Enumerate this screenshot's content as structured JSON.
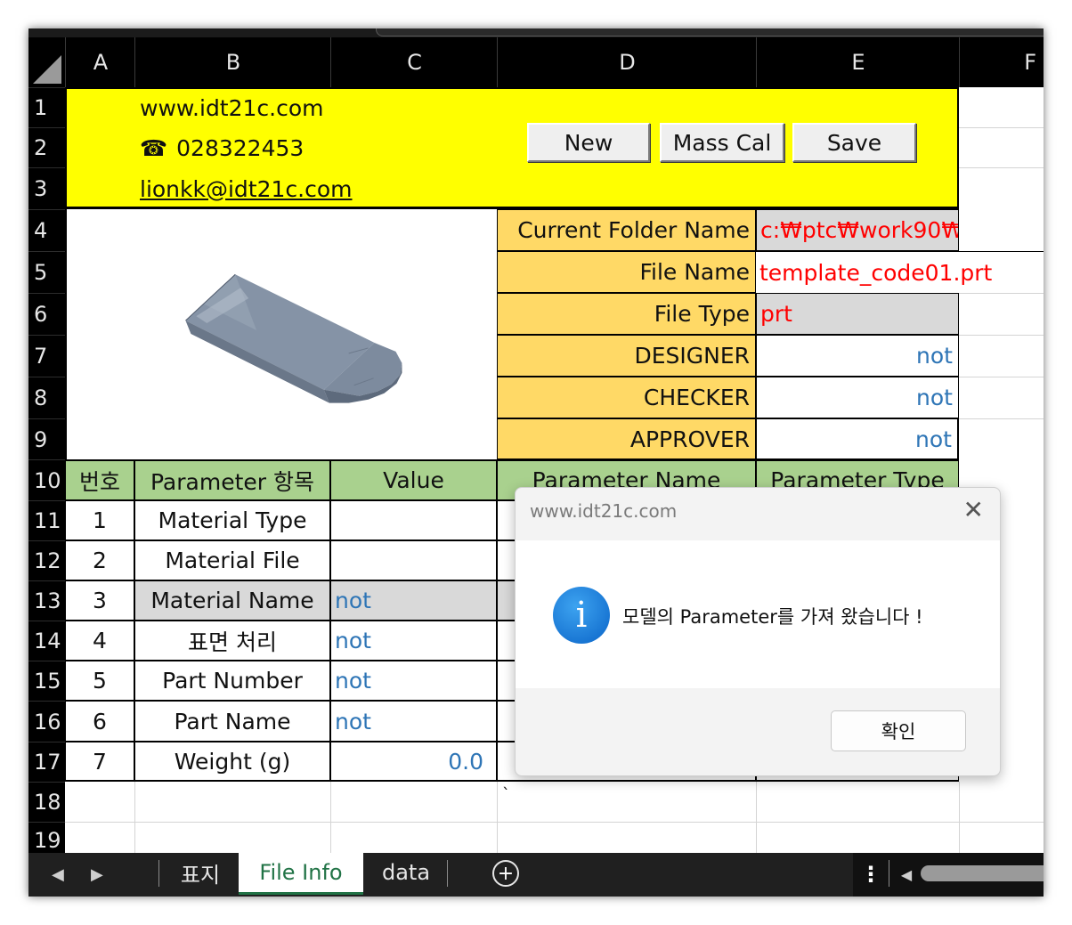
{
  "columns": [
    "A",
    "B",
    "C",
    "D",
    "E",
    "F"
  ],
  "rows": [
    "1",
    "2",
    "3",
    "4",
    "5",
    "6",
    "7",
    "8",
    "9",
    "10",
    "11",
    "12",
    "13",
    "14",
    "15",
    "16",
    "17",
    "18",
    "19"
  ],
  "header": {
    "website": "www.idt21c.com",
    "phone_icon": "☎",
    "phone": "028322453",
    "email": "lionkk@idt21c.com"
  },
  "buttons": {
    "new": "New",
    "mass_cal": "Mass Cal",
    "save": "Save"
  },
  "info": {
    "folder_label": "Current Folder Name",
    "folder_value": "c:₩ptc₩work90₩",
    "file_name_label": "File Name",
    "file_name_value": "template_code01.prt",
    "file_type_label": "File Type",
    "file_type_value": "prt",
    "designer_label": "DESIGNER",
    "designer_value": "not",
    "checker_label": "CHECKER",
    "checker_value": "not",
    "approver_label": "APPROVER",
    "approver_value": "not"
  },
  "table": {
    "headers": [
      "번호",
      "Parameter 항목",
      "Value",
      "Parameter Name",
      "Parameter Type"
    ],
    "rows": [
      {
        "no": "1",
        "item": "Material Type",
        "value": ""
      },
      {
        "no": "2",
        "item": "Material File",
        "value": ""
      },
      {
        "no": "3",
        "item": "Material Name",
        "value": "not"
      },
      {
        "no": "4",
        "item": "표면 처리",
        "value": "not"
      },
      {
        "no": "5",
        "item": "Part Number",
        "value": "not"
      },
      {
        "no": "6",
        "item": "Part Name",
        "value": "not"
      },
      {
        "no": "7",
        "item": "Weight (g)",
        "value": "0.0"
      }
    ],
    "stray_mark": "`"
  },
  "sheet_tabs": [
    "표지",
    "File Info",
    "data"
  ],
  "active_sheet": "File Info",
  "add_sheet_icon": "plus-circle-icon",
  "dialog": {
    "title": "www.idt21c.com",
    "message": "모델의 Parameter를 가져 왔습니다 !",
    "ok": "확인",
    "icon": "info-icon"
  },
  "colors": {
    "yellow": "#ffff00",
    "orange": "#ffd966",
    "green": "#a9d18e",
    "accent_green": "#217346"
  }
}
